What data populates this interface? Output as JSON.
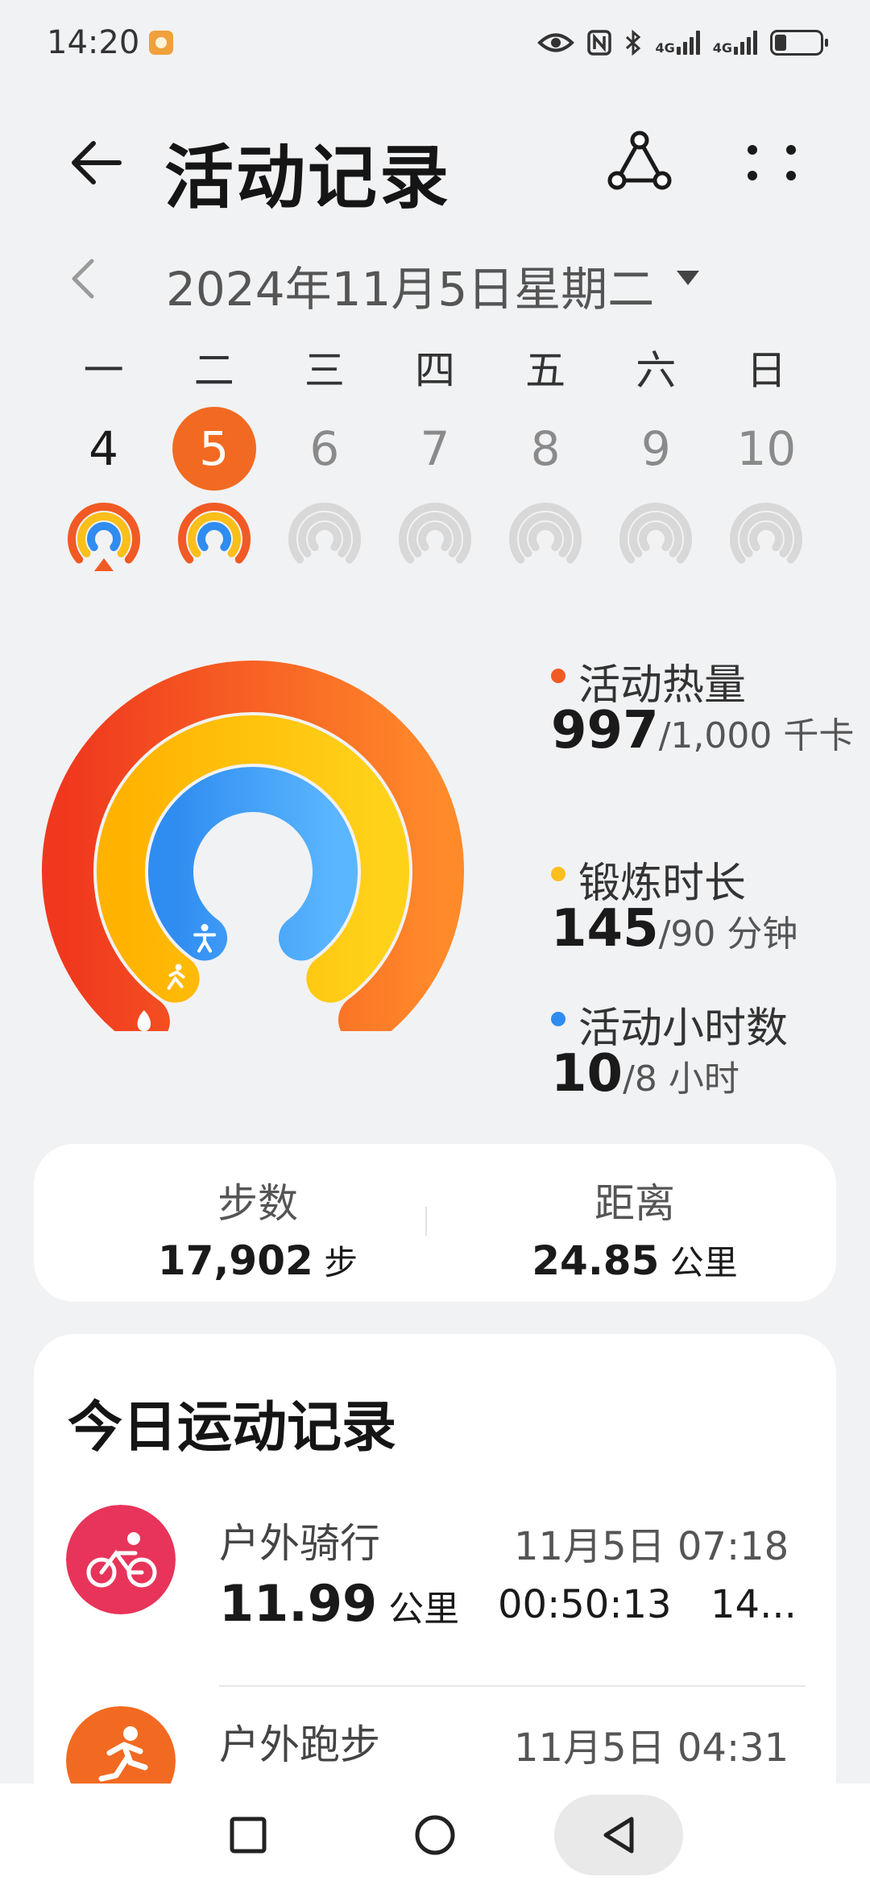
{
  "status_bar": {
    "time": "14:20",
    "net1": "4G",
    "net2": "4G",
    "icons": [
      "notification-badge-icon",
      "eye-icon",
      "nfc-icon",
      "bluetooth-icon",
      "signal-icon",
      "battery-icon"
    ]
  },
  "header": {
    "title": "活动记录",
    "back_icon": "arrow-left-icon",
    "share_icon": "share-icon",
    "more_icon": "more-dots-icon"
  },
  "date_nav": {
    "date_text": "2024年11月5日星期二",
    "prev_icon": "chevron-left-icon",
    "dropdown_icon": "caret-down-icon"
  },
  "week": {
    "weekdays": [
      "一",
      "二",
      "三",
      "四",
      "五",
      "六",
      "日"
    ],
    "days": [
      {
        "num": "4",
        "state": "past",
        "ring": "completed"
      },
      {
        "num": "5",
        "state": "selected",
        "ring": "completed"
      },
      {
        "num": "6",
        "state": "future",
        "ring": "empty"
      },
      {
        "num": "7",
        "state": "future",
        "ring": "empty"
      },
      {
        "num": "8",
        "state": "future",
        "ring": "empty"
      },
      {
        "num": "9",
        "state": "future",
        "ring": "empty"
      },
      {
        "num": "10",
        "state": "future",
        "ring": "empty"
      }
    ]
  },
  "rings": {
    "calories": {
      "label": "活动热量",
      "value": "997",
      "goal": "/1,000 千卡",
      "fraction": 0.997,
      "color": "#f15a24"
    },
    "exercise": {
      "label": "锻炼时长",
      "value": "145",
      "goal": "/90 分钟",
      "fraction": 1.61,
      "color": "#fbbf1b"
    },
    "hours": {
      "label": "活动小时数",
      "value": "10",
      "goal": "/8 小时",
      "fraction": 1.25,
      "color": "#2f8cf0"
    }
  },
  "summary": {
    "steps_label": "步数",
    "steps_value": "17,902",
    "steps_unit": " 步",
    "distance_label": "距离",
    "distance_value": "24.85",
    "distance_unit": " 公里"
  },
  "records": {
    "title": "今日运动记录",
    "items": [
      {
        "name": "户外骑行",
        "time": "11月5日 07:18",
        "distance": "11.99",
        "unit": " 公里",
        "duration": "00:50:13",
        "extra": "14...",
        "icon": "cycling-icon",
        "color": "#e8345a"
      },
      {
        "name": "户外跑步",
        "time": "11月5日 04:31",
        "icon": "running-icon",
        "color": "#f26a21"
      }
    ]
  },
  "nav": {
    "recent_icon": "square-icon",
    "home_icon": "circle-icon",
    "back_icon": "triangle-back-icon"
  }
}
